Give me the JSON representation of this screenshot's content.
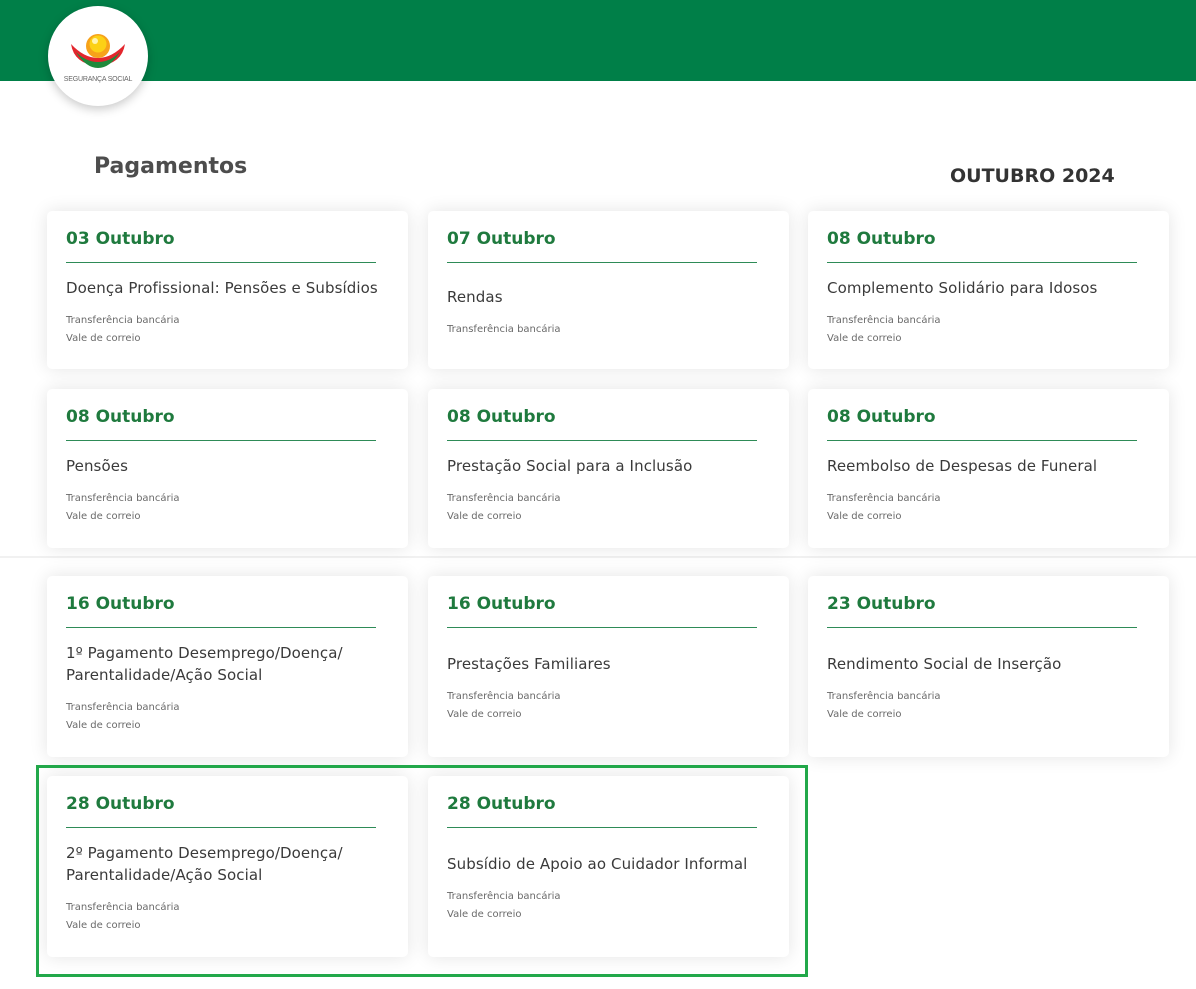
{
  "header": {
    "logo_text": "SEGURANÇA SOCIAL",
    "brand_color": "#007f48",
    "logo_colors": [
      "#f7a21a",
      "#fcd116",
      "#e3262d",
      "#1f8a3c"
    ]
  },
  "page": {
    "title": "Pagamentos",
    "month": "OUTUBRO 2024",
    "accent_color": "#1f7a3e",
    "highlight_color": "#22a84a"
  },
  "cards": [
    {
      "date": "03 Outubro",
      "title": "Doença Profissional: Pensões e Subsídios",
      "methods": [
        "Transferência bancária",
        "Vale de correio"
      ]
    },
    {
      "date": "07 Outubro",
      "title": "Rendas",
      "methods": [
        "Transferência bancária"
      ]
    },
    {
      "date": "08 Outubro",
      "title": "Complemento Solidário para Idosos",
      "methods": [
        "Transferência bancária",
        "Vale de correio"
      ]
    },
    {
      "date": "08 Outubro",
      "title": "Pensões",
      "methods": [
        "Transferência bancária",
        "Vale de correio"
      ]
    },
    {
      "date": "08 Outubro",
      "title": "Prestação Social para a Inclusão",
      "methods": [
        "Transferência bancária",
        "Vale de correio"
      ]
    },
    {
      "date": "08 Outubro",
      "title": "Reembolso de Despesas de Funeral",
      "methods": [
        "Transferência bancária",
        "Vale de correio"
      ]
    },
    {
      "date": "16 Outubro",
      "title": "1º Pagamento Desemprego/Doença/ Parentalidade/Ação Social",
      "methods": [
        "Transferência bancária",
        "Vale de correio"
      ]
    },
    {
      "date": "16 Outubro",
      "title": "Prestações Familiares",
      "methods": [
        "Transferência bancária",
        "Vale de correio"
      ]
    },
    {
      "date": "23 Outubro",
      "title": "Rendimento Social de Inserção",
      "methods": [
        "Transferência bancária",
        "Vale de correio"
      ]
    },
    {
      "date": "28 Outubro",
      "title": "2º Pagamento Desemprego/Doença/ Parentalidade/Ação Social",
      "methods": [
        "Transferência bancária",
        "Vale de correio"
      ]
    },
    {
      "date": "28 Outubro",
      "title": "Subsídio de Apoio ao Cuidador Informal",
      "methods": [
        "Transferência bancária",
        "Vale de correio"
      ]
    }
  ]
}
